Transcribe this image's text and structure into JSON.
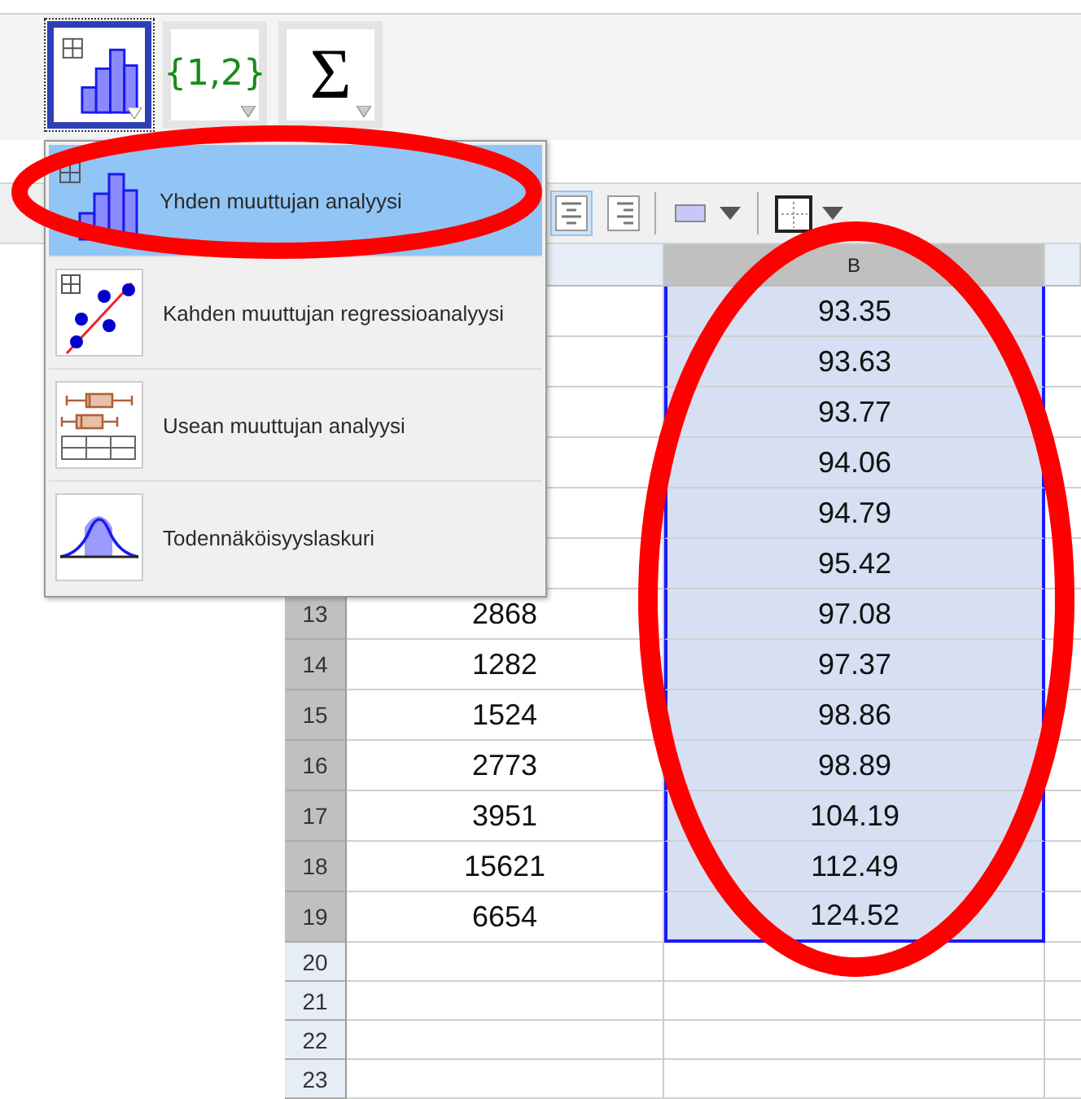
{
  "toolbar": {
    "tools": [
      {
        "kind": "histogram",
        "selected": true
      },
      {
        "kind": "text",
        "label": "{1,2}",
        "selected": false
      },
      {
        "kind": "sum",
        "label": "Σ",
        "selected": false
      }
    ]
  },
  "menu": {
    "items": [
      {
        "kind": "histogram",
        "label": "Yhden muuttujan analyysi",
        "selected": true
      },
      {
        "kind": "regression",
        "label": "Kahden muuttujan regressioanalyysi",
        "selected": false
      },
      {
        "kind": "boxplot",
        "label": "Usean muuttujan analyysi",
        "selected": false
      },
      {
        "kind": "normal",
        "label": "Todennäköisyyslaskuri",
        "selected": false
      }
    ]
  },
  "style_bar": {
    "tools": [
      {
        "kind": "align-center",
        "selected": true
      },
      {
        "kind": "align-right",
        "selected": false
      },
      {
        "kind": "fill-color"
      },
      {
        "kind": "border"
      }
    ]
  },
  "sheet": {
    "columns": [
      "B"
    ],
    "rows": [
      {
        "b": "93.35",
        "selected": true
      },
      {
        "b": "93.63",
        "selected": true
      },
      {
        "b": "93.77",
        "selected": true
      },
      {
        "b": "94.06",
        "selected": true
      },
      {
        "b": "94.79",
        "selected": true
      },
      {
        "b": "95.42",
        "selected": true
      },
      {
        "number": "13",
        "a": "2868",
        "b": "97.08",
        "selected": true
      },
      {
        "number": "14",
        "a": "1282",
        "b": "97.37",
        "selected": true
      },
      {
        "number": "15",
        "a": "1524",
        "b": "98.86",
        "selected": true
      },
      {
        "number": "16",
        "a": "2773",
        "b": "98.89",
        "selected": true
      },
      {
        "number": "17",
        "a": "3951",
        "b": "104.19",
        "selected": true
      },
      {
        "number": "18",
        "a": "15621",
        "b": "112.49",
        "selected": true
      },
      {
        "number": "19",
        "a": "6654",
        "b": "124.52",
        "selected": true
      },
      {
        "number": "20",
        "selected": false
      },
      {
        "number": "21",
        "selected": false
      },
      {
        "number": "22",
        "selected": false
      },
      {
        "number": "23",
        "selected": false
      }
    ]
  },
  "annotations": [
    {
      "kind": "ellipse"
    },
    {
      "kind": "ellipse"
    }
  ]
}
